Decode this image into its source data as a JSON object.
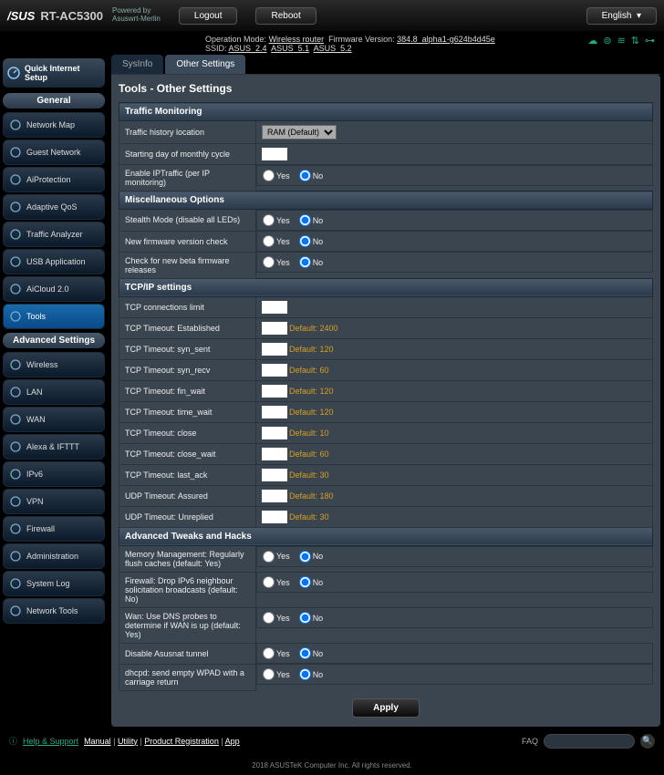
{
  "header": {
    "brand": "/SUS",
    "model": "RT-AC5300",
    "powered_label": "Powered by",
    "powered_name": "Asuswrt-Merlin",
    "logout": "Logout",
    "reboot": "Reboot",
    "language": "English"
  },
  "infobar": {
    "op_mode_label": "Operation Mode:",
    "op_mode": "Wireless router",
    "fw_label": "Firmware Version:",
    "fw": "384.8_alpha1-g624b4d45e",
    "ssid_label": "SSID:",
    "ssid1": "ASUS_2.4",
    "ssid2": "ASUS_5.1",
    "ssid3": "ASUS_5.2"
  },
  "sidebar": {
    "qis": "Quick Internet Setup",
    "general_hdr": "General",
    "general": [
      "Network Map",
      "Guest Network",
      "AiProtection",
      "Adaptive QoS",
      "Traffic Analyzer",
      "USB Application",
      "AiCloud 2.0",
      "Tools"
    ],
    "advanced_hdr": "Advanced Settings",
    "advanced": [
      "Wireless",
      "LAN",
      "WAN",
      "Alexa & IFTTT",
      "IPv6",
      "VPN",
      "Firewall",
      "Administration",
      "System Log",
      "Network Tools"
    ]
  },
  "tabs": {
    "t1": "SysInfo",
    "t2": "Other Settings"
  },
  "panel": {
    "title": "Tools - Other Settings"
  },
  "sections": {
    "traffic": {
      "hdr": "Traffic Monitoring",
      "loc_label": "Traffic history location",
      "loc_value": "RAM (Default)",
      "start_label": "Starting day of monthly cycle",
      "iptraffic_label": "Enable IPTraffic (per IP monitoring)"
    },
    "misc": {
      "hdr": "Miscellaneous Options",
      "stealth": "Stealth Mode (disable all LEDs)",
      "fwcheck": "New firmware version check",
      "betacheck": "Check for new beta firmware releases"
    },
    "tcpip": {
      "hdr": "TCP/IP settings",
      "rows": [
        {
          "label": "TCP connections limit",
          "def": ""
        },
        {
          "label": "TCP Timeout: Established",
          "def": "Default: 2400"
        },
        {
          "label": "TCP Timeout: syn_sent",
          "def": "Default: 120"
        },
        {
          "label": "TCP Timeout: syn_recv",
          "def": "Default: 60"
        },
        {
          "label": "TCP Timeout: fin_wait",
          "def": "Default: 120"
        },
        {
          "label": "TCP Timeout: time_wait",
          "def": "Default: 120"
        },
        {
          "label": "TCP Timeout: close",
          "def": "Default: 10"
        },
        {
          "label": "TCP Timeout: close_wait",
          "def": "Default: 60"
        },
        {
          "label": "TCP Timeout: last_ack",
          "def": "Default: 30"
        },
        {
          "label": "UDP Timeout: Assured",
          "def": "Default: 180"
        },
        {
          "label": "UDP Timeout: Unreplied",
          "def": "Default: 30"
        }
      ]
    },
    "adv": {
      "hdr": "Advanced Tweaks and Hacks",
      "rows": [
        "Memory Management: Regularly flush caches (default: Yes)",
        "Firewall: Drop IPv6 neighbour solicitation broadcasts (default: No)",
        "Wan: Use DNS probes to determine if WAN is up (default: Yes)",
        "Disable Asusnat tunnel",
        "dhcpd: send empty WPAD with a carriage return"
      ]
    }
  },
  "common": {
    "yes": "Yes",
    "no": "No",
    "apply": "Apply"
  },
  "footer": {
    "help": "Help & Support",
    "links": [
      "Manual",
      "Utility",
      "Product Registration",
      "App"
    ],
    "faq": "FAQ",
    "copyright": "2018 ASUSTeK Computer Inc. All rights reserved."
  }
}
